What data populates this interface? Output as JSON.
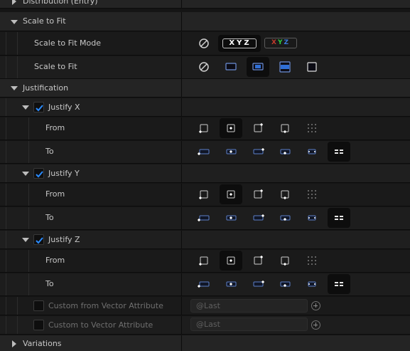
{
  "rows": {
    "distribution": "Distribution (Entry)",
    "scale_to_fit": "Scale to Fit",
    "scale_to_fit_mode": "Scale to Fit Mode",
    "scale_to_fit_prop": "Scale to Fit",
    "justification": "Justification",
    "justify_x": "Justify X",
    "justify_y": "Justify Y",
    "justify_z": "Justify Z",
    "from": "From",
    "to": "To",
    "custom_from": "Custom from Vector Attribute",
    "custom_to": "Custom to Vector Attribute",
    "variations": "Variations"
  },
  "mode_toggle": {
    "xyz_label": "XYZ",
    "x": "X",
    "y": "Y",
    "z": "Z"
  },
  "colors": {
    "x": "#c0392b",
    "y": "#2ecc40",
    "z": "#3b7bdc",
    "check": "#2a8bff",
    "fit_fill": "#2f6fd6"
  },
  "inputs": {
    "custom_from_value": "@Last",
    "custom_to_value": "@Last"
  },
  "checkboxes": {
    "justify_x": true,
    "justify_y": true,
    "justify_z": true,
    "custom_from": false,
    "custom_to": false
  },
  "selections": {
    "scale_to_fit": 2,
    "from": 1,
    "to": 5
  }
}
